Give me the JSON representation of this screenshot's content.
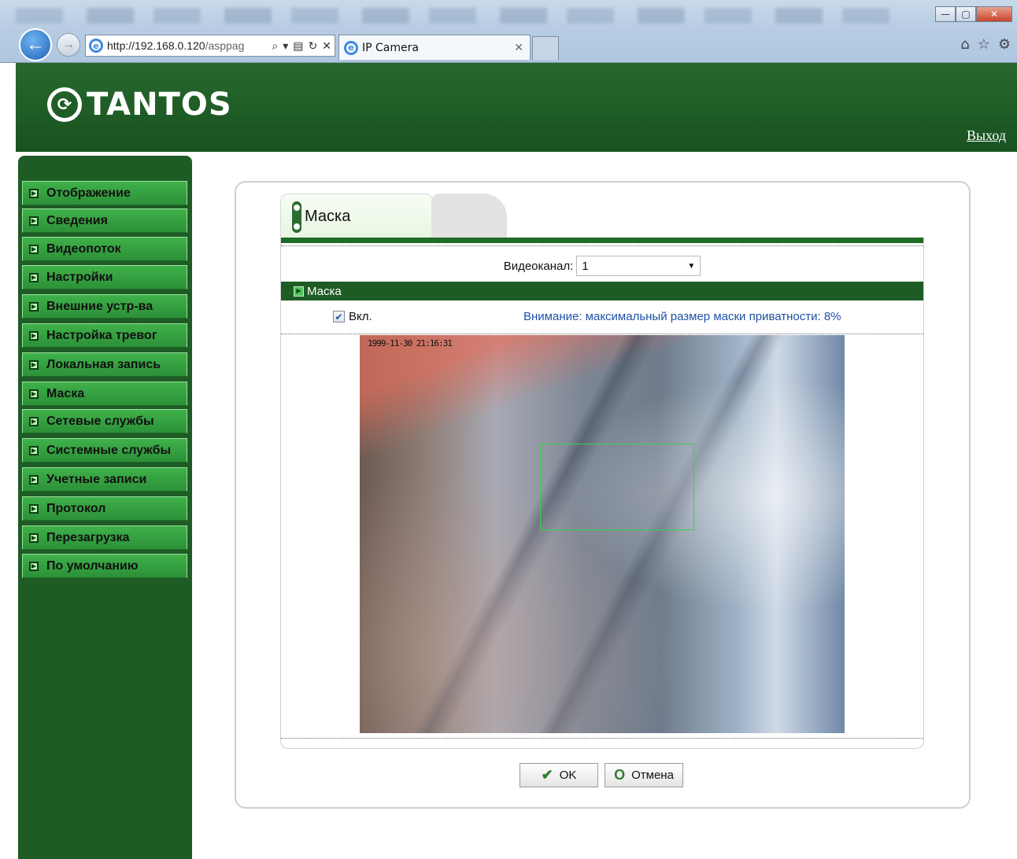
{
  "browser": {
    "url_host": "http://192.168.0.120",
    "url_path": "/asppag",
    "tab_title": "IP Camera"
  },
  "header": {
    "brand": "TANTOS",
    "logout_label": "Выход"
  },
  "sidebar": {
    "items": [
      {
        "label": "Отображение"
      },
      {
        "label": "Сведения"
      },
      {
        "label": "Видеопоток"
      },
      {
        "label": "Настройки"
      },
      {
        "label": "Внешние устр-ва"
      },
      {
        "label": "Настройка тревог"
      },
      {
        "label": "Локальная запись"
      },
      {
        "label": "Маска"
      },
      {
        "label": "Сетевые службы"
      },
      {
        "label": "Системные службы"
      },
      {
        "label": "Учетные записи"
      },
      {
        "label": "Протокол"
      },
      {
        "label": "Перезагрузка"
      },
      {
        "label": "По умолчанию"
      }
    ]
  },
  "main": {
    "tab_title": "Маска",
    "channel_label": "Видеоканал:",
    "channel_value": "1",
    "section_title": "Маска",
    "enable_label": "Вкл.",
    "enable_checked": true,
    "warning": "Внимание: максимальный размер маски приватности: 8%",
    "video_timestamp": "1999-11-30 21:16:31"
  },
  "buttons": {
    "ok": "OK",
    "cancel": "Отмена"
  },
  "colors": {
    "header_green": "#1f5c26",
    "menu_green": "#3fb14a",
    "warning_blue": "#1f50a6",
    "mask_rect": "#3bd14b"
  }
}
